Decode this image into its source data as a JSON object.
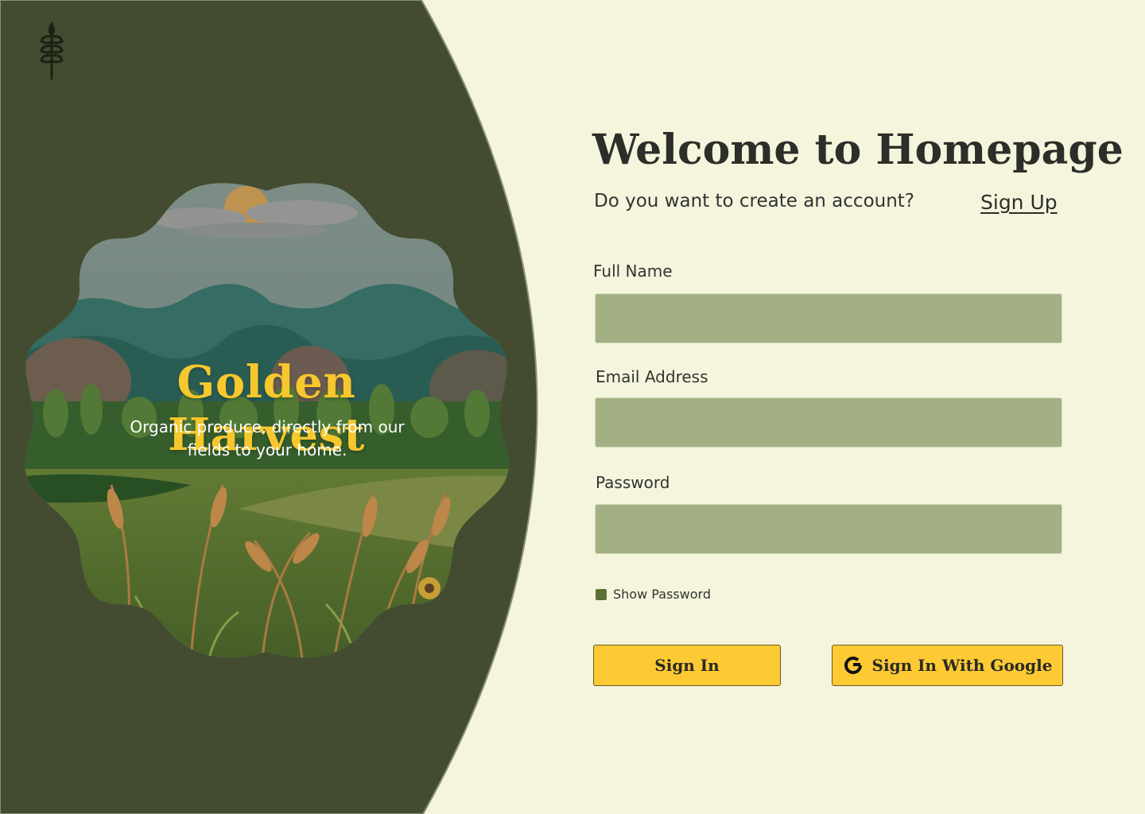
{
  "brand": {
    "logo_icon": "wheat-icon",
    "title": "Golden Harvest",
    "subtitle": "Organic produce, directly from our fields to your home."
  },
  "colors": {
    "panel_dark": "#434c31",
    "page_bg": "#f4f5dc",
    "accent_gold": "#f7c72e",
    "input_bg": "#a3b083",
    "button_bg": "#fdca33"
  },
  "main": {
    "heading": "Welcome to Homepage",
    "prompt": "Do you want to create an account?",
    "signup_link": "Sign Up"
  },
  "form": {
    "full_name_label": "Full Name",
    "full_name_value": "",
    "email_label": "Email Address",
    "email_value": "",
    "password_label": "Password",
    "password_value": "",
    "show_password_label": "Show Password",
    "show_password_checked": true
  },
  "actions": {
    "signin_label": "Sign In",
    "google_label": "Sign In With Google",
    "google_icon": "google-icon"
  }
}
